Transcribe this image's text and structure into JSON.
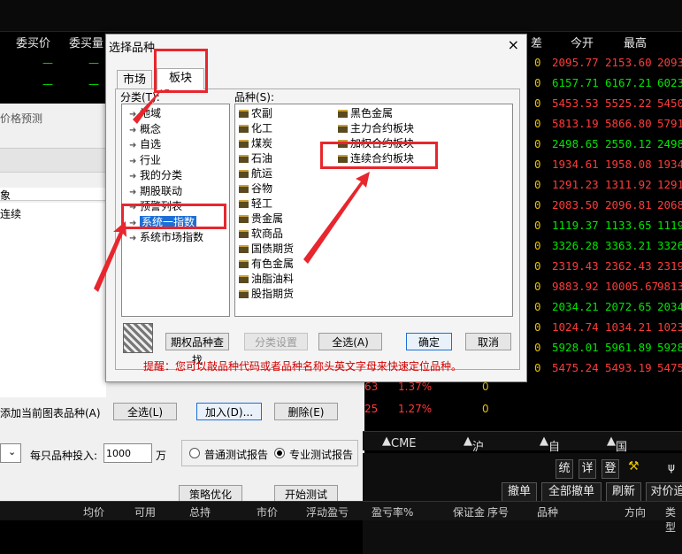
{
  "background": {
    "header": {
      "bid_price": "委买价",
      "bid_vol": "委买量",
      "spread": "差",
      "open": "今开",
      "high": "最高"
    },
    "quotes": [
      {
        "zero": "0",
        "open": "2095.77",
        "high": "2153.60",
        "last": "2093",
        "dir": "red"
      },
      {
        "zero": "0",
        "open": "6157.71",
        "high": "6167.21",
        "last": "6023",
        "dir": "green"
      },
      {
        "zero": "0",
        "open": "5453.53",
        "high": "5525.22",
        "last": "5450",
        "dir": "red"
      },
      {
        "zero": "0",
        "open": "5813.19",
        "high": "5866.80",
        "last": "5791",
        "dir": "red"
      },
      {
        "zero": "0",
        "open": "2498.65",
        "high": "2550.12",
        "last": "2498",
        "dir": "green"
      },
      {
        "zero": "0",
        "open": "1934.61",
        "high": "1958.08",
        "last": "1934",
        "dir": "red"
      },
      {
        "zero": "0",
        "open": "1291.23",
        "high": "1311.92",
        "last": "1291",
        "dir": "red"
      },
      {
        "zero": "0",
        "open": "2083.50",
        "high": "2096.81",
        "last": "2068",
        "dir": "red"
      },
      {
        "zero": "0",
        "open": "1119.37",
        "high": "1133.65",
        "last": "1119",
        "dir": "green"
      },
      {
        "zero": "0",
        "open": "3326.28",
        "high": "3363.21",
        "last": "3326",
        "dir": "green"
      },
      {
        "zero": "0",
        "open": "2319.43",
        "high": "2362.43",
        "last": "2319",
        "dir": "red"
      },
      {
        "zero": "0",
        "open": "9883.92",
        "high": "10005.67",
        "last": "9813",
        "dir": "red"
      },
      {
        "zero": "0",
        "open": "2034.21",
        "high": "2072.65",
        "last": "2034",
        "dir": "green"
      },
      {
        "zero": "0",
        "open": "1024.74",
        "high": "1034.21",
        "last": "1023",
        "dir": "red"
      },
      {
        "zero": "0",
        "open": "5928.01",
        "high": "5961.89",
        "last": "5928",
        "dir": "green"
      },
      {
        "zero": "0",
        "open": "5475.24",
        "high": "5493.19",
        "last": "5475",
        "dir": "red"
      }
    ],
    "left_rows": [
      {
        "num": "63",
        "pct": "1.37%",
        "zero": "0"
      },
      {
        "num": "25",
        "pct": "1.27%",
        "zero": "0"
      }
    ]
  },
  "left_panel": {
    "price_predict": "价格预测",
    "object_label": "象",
    "continuous": "连续",
    "add_current_label": "添加当前图表品种(A)",
    "select_all": "全选(L)",
    "add": "加入(D)...",
    "delete": "删除(E)",
    "per_invest_label": "每只品种投入:",
    "per_invest_value": "1000",
    "unit": "万",
    "normal_report": "普通测试报告",
    "pro_report": "专业测试报告",
    "optimize": "策略优化",
    "start_test": "开始测试"
  },
  "tabs_bar": [
    "CME能源",
    "沪深B股",
    "自选股",
    "国债期货"
  ],
  "order_panel": {
    "icons_text": [
      "统",
      "详",
      "登"
    ],
    "cancel": "撤单",
    "cancel_all": "全部撤单",
    "refresh": "刷新",
    "hedge": "对价追"
  },
  "bottom_cols": [
    "均价",
    "可用",
    "总持",
    "市价",
    "浮动盈亏",
    "盈亏率%",
    "保证金",
    "序号",
    "品种",
    "方向",
    "类型"
  ],
  "dialog": {
    "title": "选择品种",
    "close": "×",
    "tab_market": "市场",
    "tab_sector": "板块",
    "cat_label": "分类(T):",
    "var_label": "品种(S):",
    "categories": [
      "地域",
      "概念",
      "自选",
      "行业",
      "我的分类",
      "期股联动",
      "预警列表",
      "系统一指数",
      "系统市场指数"
    ],
    "selected_category": "系统一指数",
    "varieties_col1": [
      "农副",
      "化工",
      "煤炭",
      "石油",
      "航运",
      "谷物",
      "轻工",
      "贵金属",
      "软商品",
      "国债期货",
      "有色金属",
      "油脂油料",
      "股指期货"
    ],
    "varieties_col2": [
      "黑色金属",
      "主力合约板块",
      "加权合约板块",
      "连续合约板块"
    ],
    "btn_option_search": "期权品种查找",
    "btn_category_setting": "分类设置",
    "btn_select_all": "全选(A)",
    "btn_ok": "确定",
    "btn_cancel": "取消",
    "hint": "提醒：您可以敲品种代码或者品种名称头英文字母来快速定位品种。"
  },
  "colors": {
    "up": "#ff3b3b",
    "down": "#00e600",
    "annotation": "#e8262d",
    "selection": "#1b6fd6"
  }
}
